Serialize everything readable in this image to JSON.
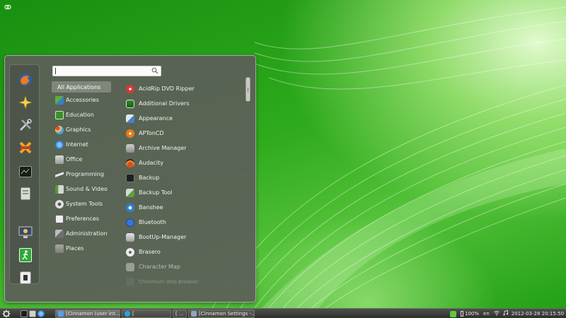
{
  "menu": {
    "search": {
      "value": "",
      "placeholder": ""
    },
    "favorites": [
      {
        "name": "firefox-icon"
      },
      {
        "name": "compiz-star-icon"
      },
      {
        "name": "system-tools-icon"
      },
      {
        "name": "cancel-x-icon"
      },
      {
        "name": "terminal-icon"
      },
      {
        "name": "file-manager-icon"
      },
      {
        "name": "lock-screen-icon"
      },
      {
        "name": "logout-icon"
      },
      {
        "name": "shutdown-icon"
      }
    ],
    "categories": [
      {
        "label": "All Applications",
        "icon": "none"
      },
      {
        "label": "Accessories",
        "icon": "accessories-icon"
      },
      {
        "label": "Education",
        "icon": "education-icon"
      },
      {
        "label": "Graphics",
        "icon": "graphics-icon"
      },
      {
        "label": "Internet",
        "icon": "internet-icon"
      },
      {
        "label": "Office",
        "icon": "office-icon"
      },
      {
        "label": "Programming",
        "icon": "programming-icon"
      },
      {
        "label": "Sound & Video",
        "icon": "sound-video-icon"
      },
      {
        "label": "System Tools",
        "icon": "system-tools-icon"
      },
      {
        "label": "Preferences",
        "icon": "preferences-icon"
      },
      {
        "label": "Administration",
        "icon": "administration-icon"
      },
      {
        "label": "Places",
        "icon": "places-icon"
      }
    ],
    "apps": [
      {
        "label": "AcidRip DVD Ripper",
        "icon": "acidrip-icon"
      },
      {
        "label": "Additional Drivers",
        "icon": "drivers-icon"
      },
      {
        "label": "Appearance",
        "icon": "appearance-icon"
      },
      {
        "label": "APTonCD",
        "icon": "aptoncd-icon"
      },
      {
        "label": "Archive Manager",
        "icon": "archive-icon"
      },
      {
        "label": "Audacity",
        "icon": "audacity-icon"
      },
      {
        "label": "Backup",
        "icon": "backup-icon"
      },
      {
        "label": "Backup Tool",
        "icon": "backup-tool-icon"
      },
      {
        "label": "Banshee",
        "icon": "banshee-icon"
      },
      {
        "label": "Bluetooth",
        "icon": "bluetooth-icon"
      },
      {
        "label": "BootUp-Manager",
        "icon": "bootup-icon"
      },
      {
        "label": "Brasero",
        "icon": "brasero-icon"
      },
      {
        "label": "Character Map",
        "icon": "charmap-icon"
      },
      {
        "label": "Chromium Web Browser",
        "icon": "chromium-icon"
      }
    ]
  },
  "panel": {
    "windows": [
      {
        "label": "[Cinnamon (user int...",
        "icon": "shield-icon"
      },
      {
        "label": "[",
        "icon": "skype-icon"
      },
      {
        "label": "[ ...",
        "icon": "none"
      },
      {
        "label": "[Cinnamon Settings -...",
        "icon": "settings-icon"
      }
    ],
    "tray": {
      "battery": "100%",
      "keyboard": "en",
      "clock": "2012-03-28 20:15:50"
    }
  },
  "colors": {
    "wallpaper": "#22a016",
    "menu_bg": "#5c5f58",
    "panel_bg": "#3b3d39"
  }
}
